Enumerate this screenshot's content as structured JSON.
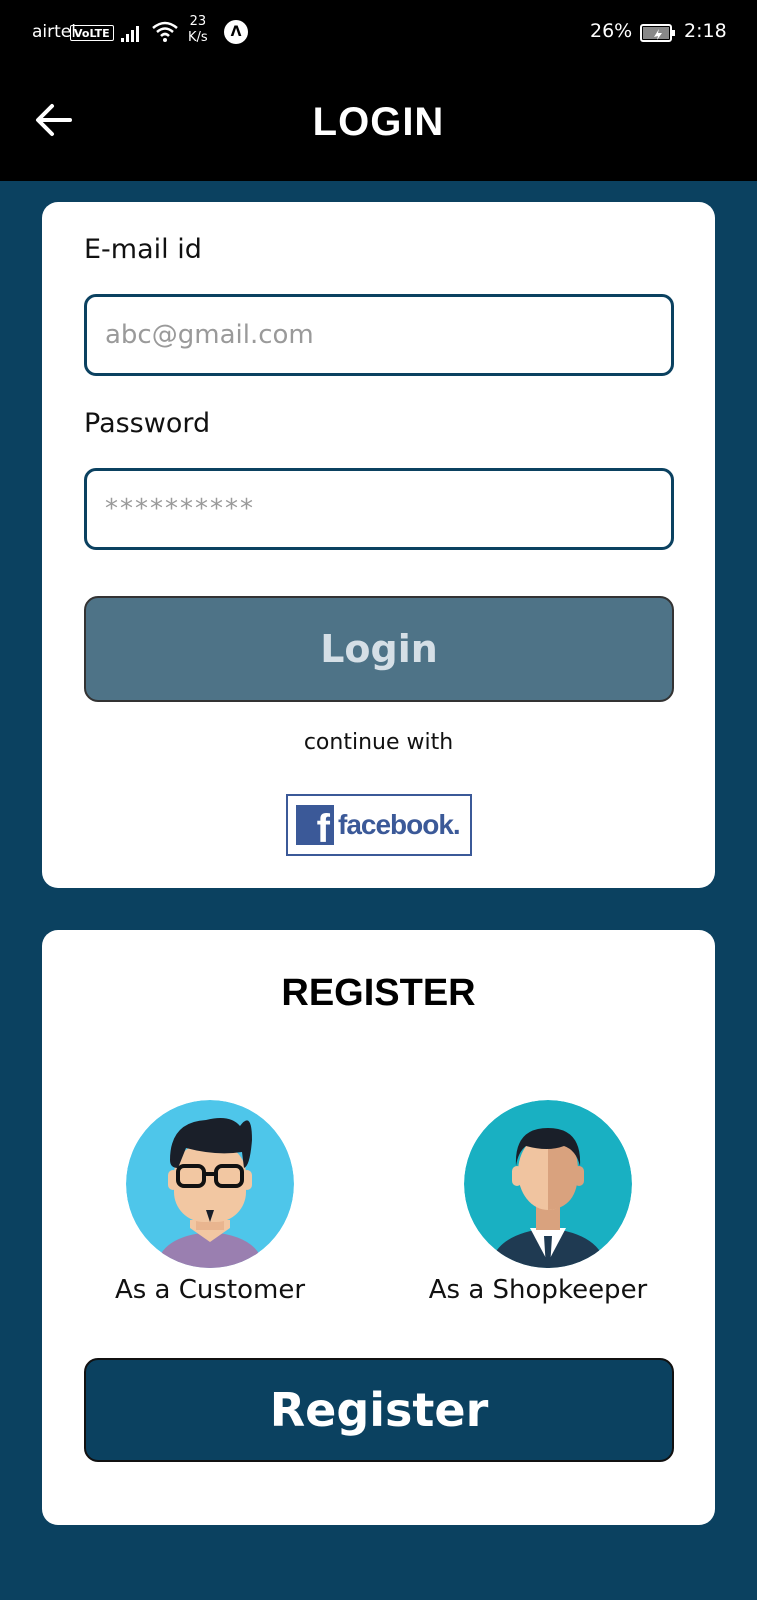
{
  "status_bar": {
    "carrier": "airtel",
    "volte": "VoLTE",
    "speed_value": "23",
    "speed_unit": "K/s",
    "nav_glyph": "Λ",
    "battery_percent": "26%",
    "time": "2:18"
  },
  "app_bar": {
    "back_icon": "arrow-left-icon",
    "title": "LOGIN"
  },
  "login": {
    "email_label": "E-mail id",
    "email_placeholder": "abc@gmail.com",
    "password_label": "Password",
    "password_placeholder": "**********",
    "login_button": "Login",
    "continue_text": "continue with",
    "facebook_glyph": "f",
    "facebook_text": "facebook."
  },
  "register": {
    "title": "REGISTER",
    "customer_caption": "As a Customer",
    "shopkeeper_caption": "As a Shopkeeper",
    "register_button": "Register"
  },
  "colors": {
    "background": "#0b4160",
    "app_bar": "#000000",
    "login_button": "#4e7387",
    "register_button": "#0b4160",
    "facebook_blue": "#3b5998"
  }
}
